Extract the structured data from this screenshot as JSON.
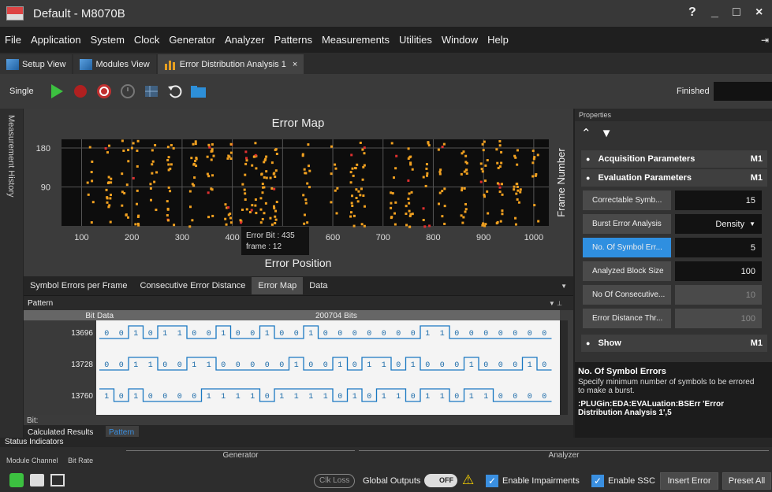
{
  "window": {
    "title": "Default - M8070B",
    "help": "?",
    "minimize": "_",
    "maximize": "□",
    "close": "×"
  },
  "menu": [
    "File",
    "Application",
    "System",
    "Clock",
    "Generator",
    "Analyzer",
    "Patterns",
    "Measurements",
    "Utilities",
    "Window",
    "Help"
  ],
  "tabs": [
    {
      "label": "Setup View"
    },
    {
      "label": "Modules View"
    },
    {
      "label": "Error Distribution Analysis 1",
      "close": "×"
    }
  ],
  "toolbar": {
    "mode": "Single",
    "status": "Finished"
  },
  "side_tab": "Measurement History",
  "error_map": {
    "title": "Error Map",
    "xlabel": "Error Position",
    "ylabel": "Frame Number",
    "x_ticks": [
      "100",
      "200",
      "300",
      "400",
      "500",
      "600",
      "700",
      "800",
      "900",
      "1000"
    ],
    "y_ticks": [
      "180",
      "90"
    ],
    "tooltip": {
      "line1": "Error Bit : 435",
      "line2": "frame : 12"
    }
  },
  "chart_data": {
    "type": "scatter",
    "title": "Error Map",
    "xlabel": "Error Position",
    "ylabel": "Frame Number",
    "xlim": [
      60,
      1030
    ],
    "ylim": [
      0,
      200
    ],
    "note_density": "dense vertical clusters of errors; approx cluster x positions below",
    "cluster_x": [
      115,
      150,
      185,
      205,
      240,
      275,
      320,
      355,
      390,
      420,
      440,
      460,
      480,
      545,
      600,
      640,
      655,
      720,
      750,
      785,
      815,
      860,
      900,
      930,
      965,
      1000
    ],
    "highlight_colors": {
      "error": "#f0a020",
      "burst": "#e03030"
    }
  },
  "sub_tabs": [
    "Symbol Errors per Frame",
    "Consecutive Error Distance",
    "Error Map",
    "Data"
  ],
  "pattern": {
    "panel_title": "Pattern",
    "col_bit": "Bit",
    "col_data": "Data",
    "header_bits": "200704 Bits",
    "bit_label": "Bit:",
    "rows": [
      {
        "bit": "13696",
        "data": "0010110010010010000000110000000"
      },
      {
        "bit": "13728",
        "data": "0011001100000100101101000100010"
      },
      {
        "bit": "13760",
        "data": "1010000111101111010110110110000"
      }
    ]
  },
  "bottom_tabs": [
    "Calculated Results",
    "Pattern"
  ],
  "properties": {
    "title": "Properties",
    "acq": {
      "label": "Acquisition Parameters",
      "tag": "M1"
    },
    "eval": {
      "label": "Evaluation Parameters",
      "tag": "M1"
    },
    "rows": [
      {
        "label": "Correctable Symb...",
        "value": "15"
      },
      {
        "label": "Burst Error Analysis",
        "value": "Density"
      },
      {
        "label": "No. Of Symbol Err...",
        "value": "5"
      },
      {
        "label": "Analyzed Block Size",
        "value": "100"
      },
      {
        "label": "No Of Consecutive...",
        "value": "10"
      },
      {
        "label": "Error Distance Thr...",
        "value": "100"
      }
    ],
    "show": {
      "label": "Show",
      "tag": "M1"
    },
    "desc_title": "No. Of Symbol Errors",
    "desc_text": "Specify minimum number of symbols to be errored to make a burst.",
    "desc_cmd": ":PLUGin:EDA:EVALuation:BSErr 'Error Distribution Analysis 1',5"
  },
  "status": {
    "title": "Status Indicators",
    "col1": "Module Channel",
    "col2": "Bit Rate",
    "generator": "Generator",
    "analyzer": "Analyzer",
    "clk_loss": "Clk Loss",
    "global_outputs": "Global Outputs",
    "toggle": "OFF",
    "enable_impairments": "Enable Impairments",
    "enable_ssc": "Enable SSC",
    "insert_error": "Insert Error",
    "preset_all": "Preset All"
  }
}
